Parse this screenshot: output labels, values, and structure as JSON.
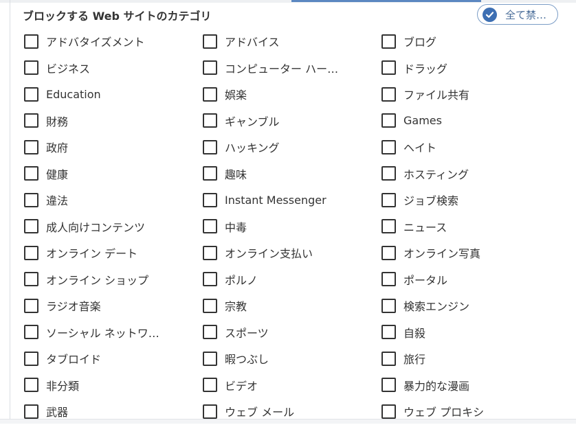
{
  "section": {
    "title": "ブロックする Web サイトのカテゴリ"
  },
  "block_all_button": {
    "label": "全て禁…",
    "icon": "check-circle-icon",
    "accent": "#3d6fb3"
  },
  "categories": {
    "rows": [
      [
        "アドバタイズメント",
        "アドバイス",
        "ブログ"
      ],
      [
        "ビジネス",
        "コンピューター ハー…",
        "ドラッグ"
      ],
      [
        "Education",
        "娯楽",
        "ファイル共有"
      ],
      [
        "財務",
        "ギャンブル",
        "Games"
      ],
      [
        "政府",
        "ハッキング",
        "ヘイト"
      ],
      [
        "健康",
        "趣味",
        "ホスティング"
      ],
      [
        "違法",
        "Instant Messenger",
        "ジョブ検索"
      ],
      [
        "成人向けコンテンツ",
        "中毒",
        "ニュース"
      ],
      [
        "オンライン デート",
        "オンライン支払い",
        "オンライン写真"
      ],
      [
        "オンライン ショップ",
        "ポルノ",
        "ポータル"
      ],
      [
        "ラジオ音楽",
        "宗教",
        "検索エンジン"
      ],
      [
        "ソーシャル ネットワ…",
        "スポーツ",
        "自殺"
      ],
      [
        "タブロイド",
        "暇つぶし",
        "旅行"
      ],
      [
        "非分類",
        "ビデオ",
        "暴力的な漫画"
      ],
      [
        "武器",
        "ウェブ メール",
        "ウェブ プロキシ"
      ]
    ],
    "checked": false
  }
}
